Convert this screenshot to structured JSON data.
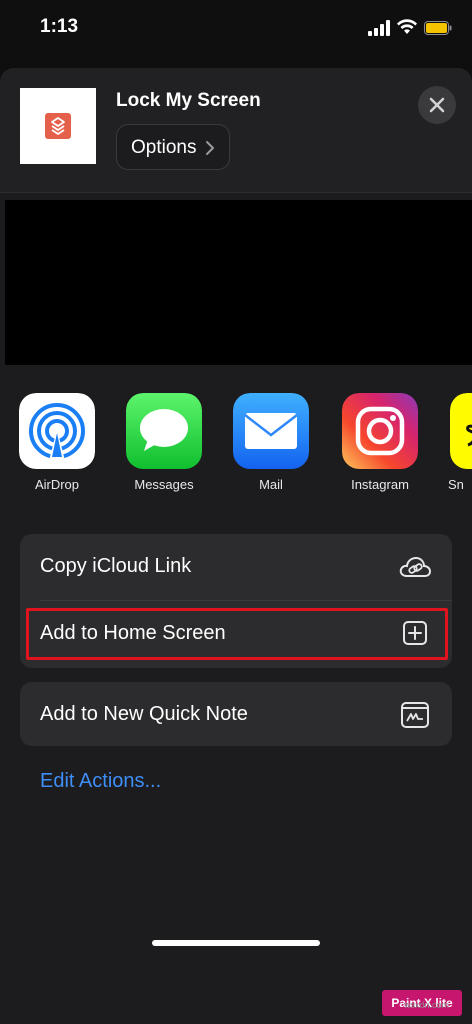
{
  "status_bar": {
    "time": "1:13"
  },
  "header": {
    "title": "Lock My Screen",
    "options_label": "Options",
    "close_icon": "close-icon",
    "shortcut_icon_color": "#e5604a"
  },
  "apps": [
    {
      "label": "AirDrop",
      "icon": "airdrop-icon"
    },
    {
      "label": "Messages",
      "icon": "messages-icon"
    },
    {
      "label": "Mail",
      "icon": "mail-icon"
    },
    {
      "label": "Instagram",
      "icon": "instagram-icon"
    },
    {
      "label": "Sn",
      "icon": "snapchat-icon"
    }
  ],
  "actions": [
    {
      "label": "Copy iCloud Link",
      "icon": "icloud-link-icon"
    },
    {
      "label": "Add to Home Screen",
      "icon": "add-square-icon",
      "highlighted": true
    }
  ],
  "quick_note": {
    "label": "Add to New Quick Note",
    "icon": "quick-note-icon"
  },
  "edit_actions": "Edit Actions...",
  "watermark": {
    "title": "Paint X lite",
    "subtitle": "wsxdn.com"
  },
  "colors": {
    "accent": "#3e8ef7",
    "highlight": "#e0141e",
    "sheet": "#1c1c1e"
  }
}
